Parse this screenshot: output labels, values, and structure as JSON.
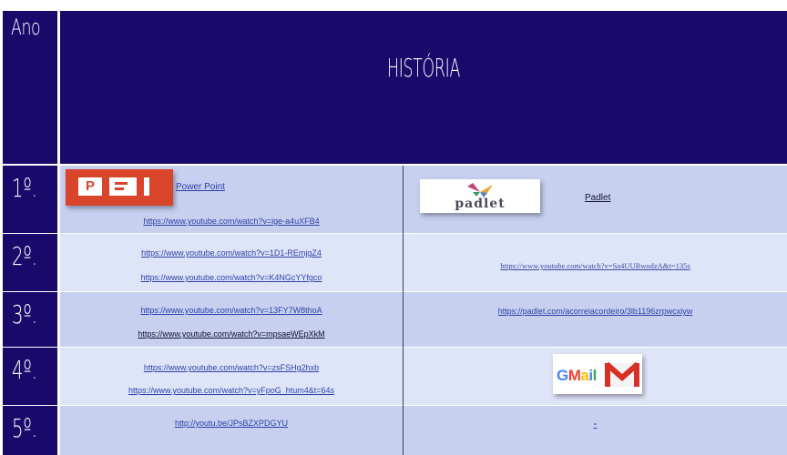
{
  "header": {
    "ano_label": "Ano",
    "title": "HISTÓRIA"
  },
  "rows": [
    {
      "year": "1º.",
      "left": {
        "icon_label": "Power Point",
        "link": "https://www.youtube.com/watch?v=ige-a4uXFB4"
      },
      "right": {
        "logo": "padlet",
        "logo_text": "padlet",
        "label": "Padlet"
      }
    },
    {
      "year": "2º.",
      "left": {
        "link1": "https://www.youtube.com/watch?v=1D1-REmjgZ4",
        "link2": "https://www.youtube.com/watch?v=K4NGcYYfgco"
      },
      "right": {
        "link": "https://www.youtube.com/watch?v=Sa4UURwodzA&t=135s"
      }
    },
    {
      "year": "3º.",
      "left": {
        "link1": "https://www.youtube.com/watch?v=13FY7W8thoA",
        "link2": "https://www.youtube.com/watch?v=mpsaeWEpXkM"
      },
      "right": {
        "link": "https://padlet.com/acorreiacordeiro/3lb1196zrpwcxiyw"
      }
    },
    {
      "year": "4º.",
      "left": {
        "link1": "https://www.youtube.com/watch?v=zsFSHg2hxb",
        "link2": "https://www.youtube.com/watch?v=yFpoG_htum4&t=64s"
      },
      "right": {
        "logo": "gmail",
        "logo_text": "Gmail"
      }
    },
    {
      "year": "5º.",
      "left": {
        "link": "http://youtu.be/JPsBZXPDGYU"
      },
      "right": {
        "text": "-"
      }
    }
  ],
  "colors": {
    "navy": "#19096b",
    "row_dark": "#c7d0ef",
    "row_light": "#dfe5f8",
    "ppt": "#d8452a"
  },
  "icons": [
    "powerpoint-icon",
    "padlet-logo",
    "gmail-logo"
  ]
}
